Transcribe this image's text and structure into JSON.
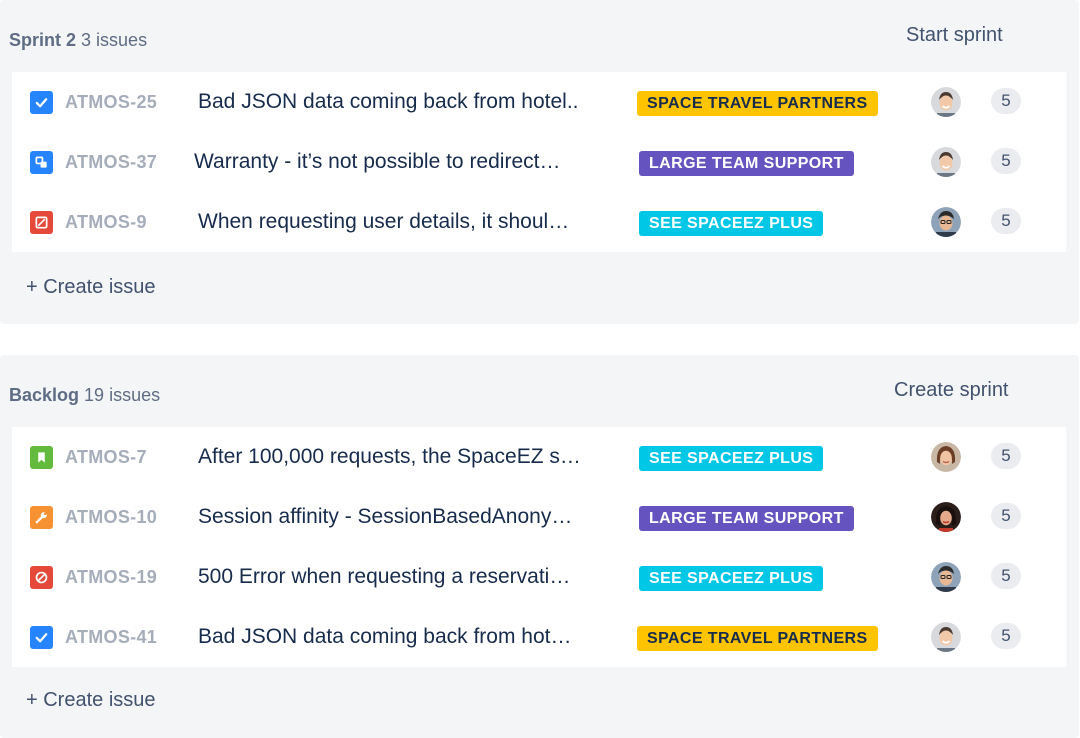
{
  "sprint": {
    "name": "Sprint 2",
    "count": "3 issues",
    "action": "Start sprint",
    "create_label": "+ Create issue",
    "issues": [
      {
        "type": "task",
        "type_color": "#2684ff",
        "key": "ATMOS-25",
        "summary": "Bad JSON data coming back from hotel..",
        "epic": "SPACE TRAVEL PARTNERS",
        "epic_color": "#ffc400",
        "avatar": "avatar-man-smiling",
        "points": "5"
      },
      {
        "type": "subtask",
        "type_color": "#2684ff",
        "key": "ATMOS-37",
        "summary": "Warranty - it’s not possible to redirect…",
        "epic": "LARGE TEAM SUPPORT",
        "epic_color": "#6554c0",
        "avatar": "avatar-man-smiling",
        "points": "5"
      },
      {
        "type": "bug",
        "type_color": "#e5493a",
        "key": "ATMOS-9",
        "summary": "When requesting user details, it shoul…",
        "epic": "SEE SPACEEZ PLUS",
        "epic_color": "#00c7e6",
        "avatar": "avatar-man-glasses",
        "points": "5"
      }
    ]
  },
  "backlog": {
    "name": "Backlog",
    "count": "19 issues",
    "action": "Create sprint",
    "create_label": "+ Create issue",
    "issues": [
      {
        "type": "story",
        "type_color": "#63ba3c",
        "key": "ATMOS-7",
        "summary": "After 100,000 requests, the SpaceEZ s…",
        "epic": "SEE SPACEEZ PLUS",
        "epic_color": "#00c7e6",
        "avatar": "avatar-woman",
        "points": "5"
      },
      {
        "type": "improvement",
        "type_color": "#f79233",
        "key": "ATMOS-10",
        "summary": "Session affinity - SessionBasedAnony…",
        "epic": "LARGE TEAM SUPPORT",
        "epic_color": "#6554c0",
        "avatar": "avatar-woman-dark",
        "points": "5"
      },
      {
        "type": "blocker",
        "type_color": "#e5493a",
        "key": "ATMOS-19",
        "summary": "500 Error when requesting a reservati…",
        "epic": "SEE SPACEEZ PLUS",
        "epic_color": "#00c7e6",
        "avatar": "avatar-man-glasses",
        "points": "5"
      },
      {
        "type": "task",
        "type_color": "#2684ff",
        "key": "ATMOS-41",
        "summary": "Bad JSON data coming back from hot…",
        "epic": "SPACE TRAVEL PARTNERS",
        "epic_color": "#ffc400",
        "avatar": "avatar-man-smiling",
        "points": "5"
      }
    ]
  }
}
